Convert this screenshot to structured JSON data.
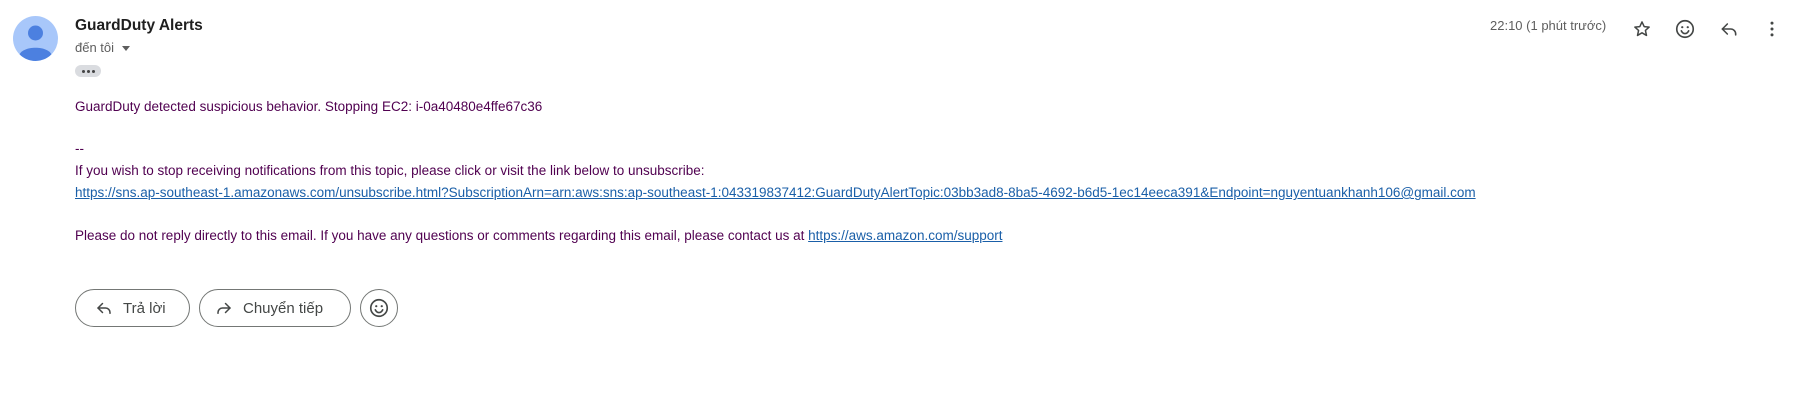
{
  "email": {
    "sender": "GuardDuty Alerts",
    "recipient": "đến tôi",
    "timestamp": "22:10 (1 phút trước)",
    "body_line1": "GuardDuty detected suspicious behavior. Stopping EC2: i-0a40480e4ffe67c36",
    "separator": "--",
    "unsubscribe_text": "If you wish to stop receiving notifications from this topic, please click or visit the link below to unsubscribe:",
    "unsubscribe_link": "https://sns.ap-southeast-1.amazonaws.com/unsubscribe.html?SubscriptionArn=arn:aws:sns:ap-southeast-1:043319837412:GuardDutyAlertTopic:03bb3ad8-8ba5-4692-b6d5-1ec14eeca391&Endpoint=nguyentuankhanh106@gmail.com",
    "footer_text": "Please do not reply directly to this email. If you have any questions or comments regarding this email, please contact us at ",
    "support_link": "https://aws.amazon.com/support"
  },
  "actions": {
    "reply_label": "Trả lời",
    "forward_label": "Chuyển tiếp"
  },
  "icons": {
    "header": [
      "star-icon",
      "emoji-icon",
      "reply-icon",
      "more-vert-icon"
    ],
    "buttons": [
      "reply-icon",
      "forward-icon",
      "emoji-icon"
    ]
  },
  "colors": {
    "body_text": "#500050",
    "link": "#1a5fa8",
    "avatar_bg": "#a8c7fa",
    "avatar_fg": "#4c80e0"
  }
}
